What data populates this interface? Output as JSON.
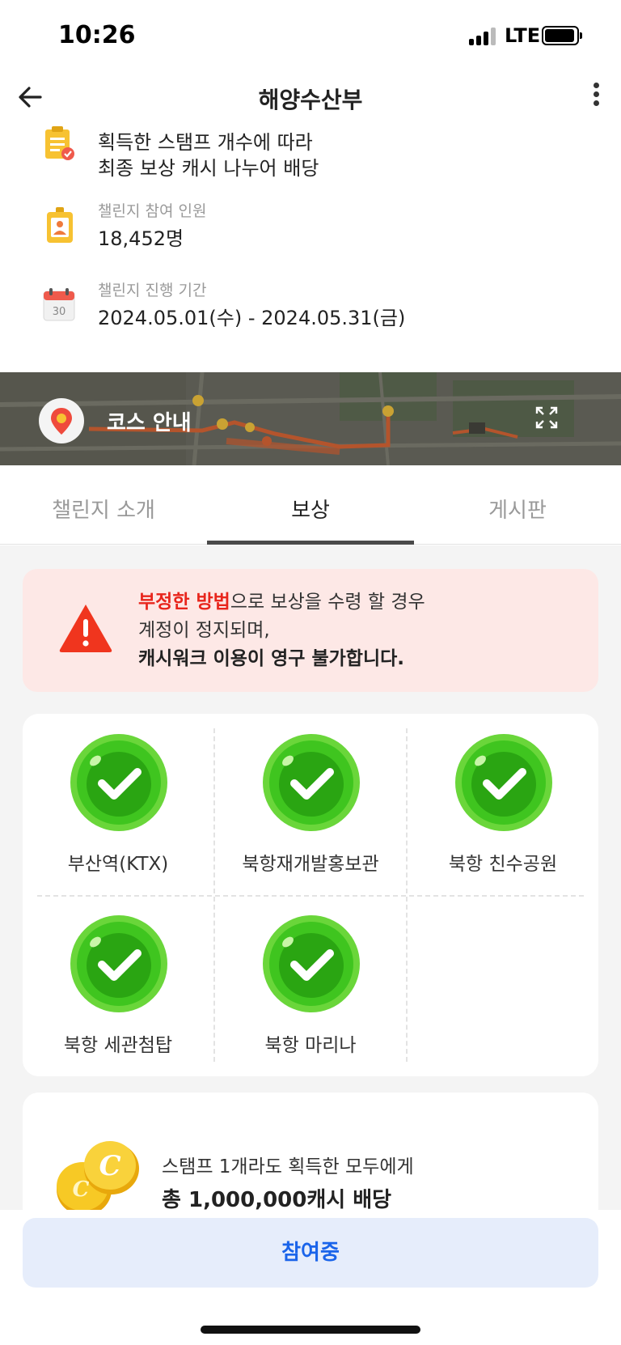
{
  "status_bar": {
    "time": "10:26",
    "network": "LTE"
  },
  "nav": {
    "title": "해양수산부"
  },
  "info": {
    "reward_rule": {
      "line1": "획득한 스탬프 개수에 따라",
      "line2": "최종 보상 캐시 나누어 배당"
    },
    "participants": {
      "label": "챌린지 참여 인원",
      "value": "18,452명"
    },
    "period": {
      "label": "챌린지 진행 기간",
      "value": "2024.05.01(수) - 2024.05.31(금)"
    }
  },
  "course": {
    "label": "코스 안내"
  },
  "tabs": [
    {
      "label": "챌린지 소개"
    },
    {
      "label": "보상"
    },
    {
      "label": "게시판"
    }
  ],
  "active_tab": "보상",
  "warning": {
    "highlight": "부정한 방법",
    "line1_rest": "으로 보상을 수령 할 경우",
    "line2": "계정이 정지되며,",
    "line3": "캐시워크 이용이 영구 불가합니다."
  },
  "stamps": [
    {
      "label": "부산역(KTX)",
      "completed": true
    },
    {
      "label": "북항재개발홍보관",
      "completed": true
    },
    {
      "label": "북항 친수공원",
      "completed": true
    },
    {
      "label": "북항 세관첨탑",
      "completed": true
    },
    {
      "label": "북항 마리나",
      "completed": true
    }
  ],
  "reward": {
    "line1": "스탬프 1개라도 획득한 모두에게",
    "line2": "총 1,000,000캐시 배당"
  },
  "join_button": {
    "label": "참여중"
  },
  "colors": {
    "accent_blue": "#1a64ea",
    "warning_red": "#e8251c",
    "stamp_green": "#3fc51f",
    "coin_yellow": "#f5c518"
  }
}
